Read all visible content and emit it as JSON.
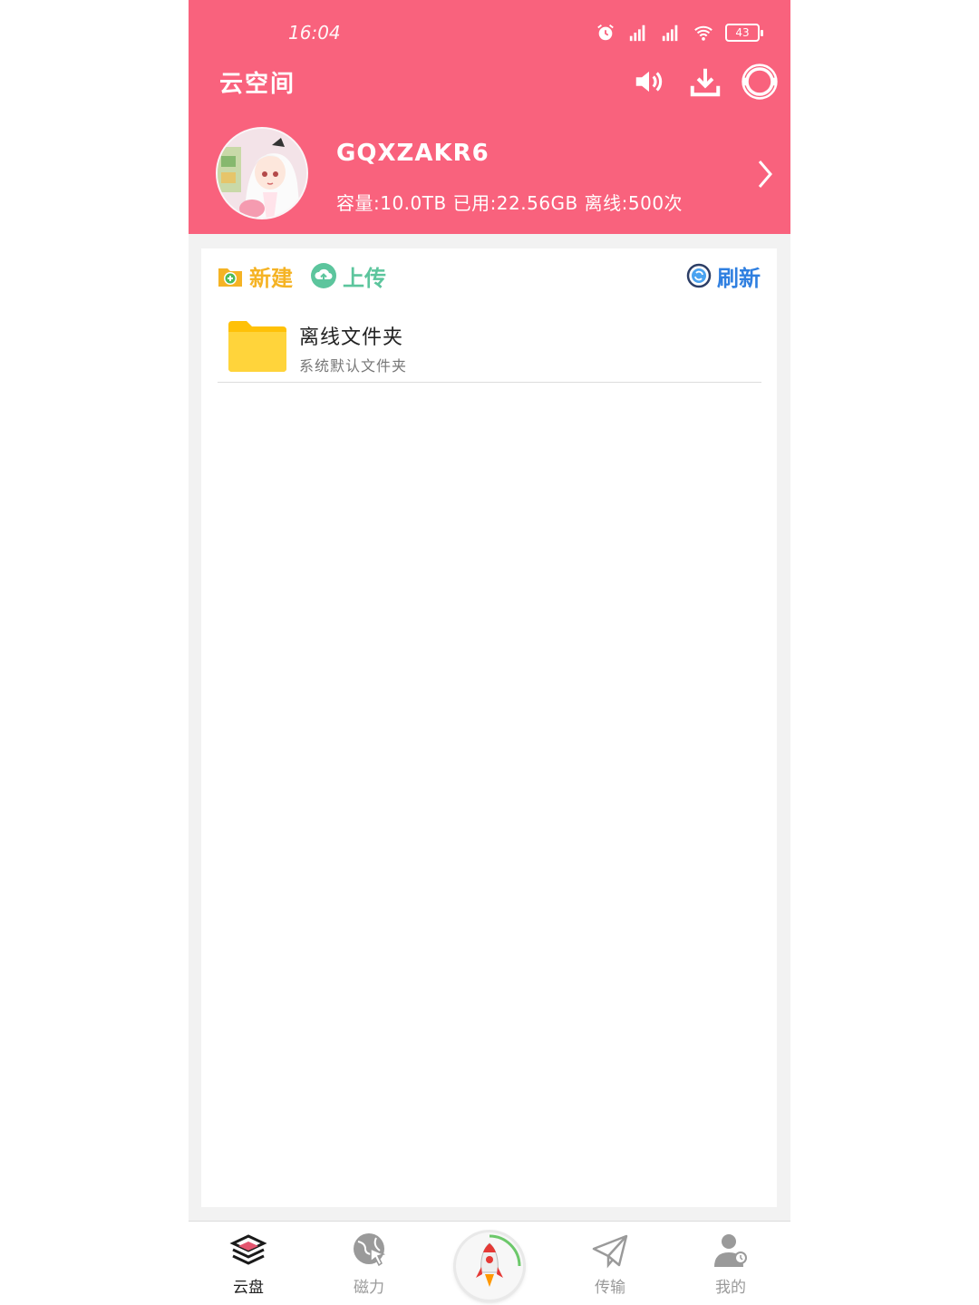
{
  "status_bar": {
    "time": "16:04",
    "battery": "43"
  },
  "header": {
    "title": "云空间",
    "username": "GQXZAKR6",
    "quota_text": "容量:10.0TB 已用:22.56GB 离线:500次"
  },
  "toolbar": {
    "new_label": "新建",
    "upload_label": "上传",
    "refresh_label": "刷新"
  },
  "files": [
    {
      "name": "离线文件夹",
      "description": "系统默认文件夹"
    }
  ],
  "tabs": [
    {
      "label": "云盘",
      "active": true
    },
    {
      "label": "磁力",
      "active": false
    },
    {
      "label": "传输",
      "active": false
    },
    {
      "label": "我的",
      "active": false
    }
  ],
  "colors": {
    "header_bg": "#f9627d",
    "new": "#f5b324",
    "upload": "#5cc59d",
    "refresh": "#2f7fe0",
    "folder": "#ffd02e"
  }
}
